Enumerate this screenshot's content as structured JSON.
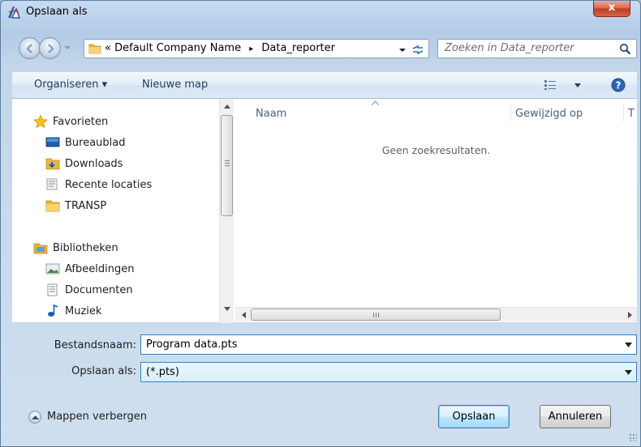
{
  "window": {
    "title": "Opslaan als",
    "close_label": "x"
  },
  "navigation": {
    "breadcrumb_prefix": "«",
    "breadcrumb": [
      "Default Company Name",
      "Data_reporter"
    ],
    "breadcrumb_separator": "▸",
    "search_placeholder": "Zoeken in Data_reporter"
  },
  "toolbar": {
    "organize_label": "Organiseren ▾",
    "new_folder_label": "Nieuwe map"
  },
  "sidebar": {
    "favorites_label": "Favorieten",
    "favorites": [
      "Bureaublad",
      "Downloads",
      "Recente locaties",
      "TRANSP"
    ],
    "libraries_label": "Bibliotheken",
    "libraries": [
      "Afbeeldingen",
      "Documenten",
      "Muziek"
    ]
  },
  "file_list": {
    "columns": [
      "Naam",
      "Gewijzigd op",
      "T"
    ],
    "empty_message": "Geen zoekresultaten."
  },
  "form": {
    "filename_label": "Bestandsnaam:",
    "filename_value": "Program data.pts",
    "savetype_label": "Opslaan als:",
    "savetype_value": "(*.pts)"
  },
  "footer": {
    "hide_folders_label": "Mappen verbergen",
    "save_label": "Opslaan",
    "cancel_label": "Annuleren"
  },
  "colors": {
    "accent": "#3c7fb1",
    "close": "#c23a1f",
    "folder": "#e8b73c"
  }
}
